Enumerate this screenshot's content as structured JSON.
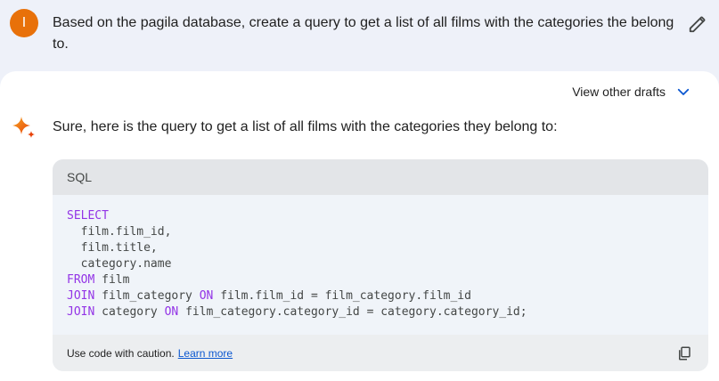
{
  "prompt": {
    "avatar_letter": "I",
    "text": "Based on the pagila database, create a query to  get a list of all films with the categories the belong to."
  },
  "response": {
    "drafts_label": "View other drafts",
    "intro": "Sure, here is the query to get a list of all films with the categories they belong to:",
    "code": {
      "language": "SQL",
      "lines": [
        {
          "kw": "SELECT",
          "rest": ""
        },
        {
          "kw": "",
          "rest": "  film.film_id,"
        },
        {
          "kw": "",
          "rest": "  film.title,"
        },
        {
          "kw": "",
          "rest": "  category.name"
        },
        {
          "kw": "FROM",
          "rest": " film"
        },
        {
          "kw": "JOIN",
          "rest": " film_category ",
          "kw2": "ON",
          "rest2": " film.film_id = film_category.film_id"
        },
        {
          "kw": "JOIN",
          "rest": " category ",
          "kw2": "ON",
          "rest2": " film_category.category_id = category.category_id;"
        }
      ]
    },
    "footer": {
      "caution": "Use code with caution.",
      "learn_more": "Learn more"
    }
  },
  "icons": {
    "edit": "pencil-icon",
    "drafts": "chevron-down-icon",
    "assistant": "sparkle-icon",
    "copy": "copy-icon"
  },
  "colors": {
    "avatar": "#e8710a",
    "keyword": "#9334e6",
    "link": "#0b57d0",
    "chevron": "#0b57d0"
  }
}
